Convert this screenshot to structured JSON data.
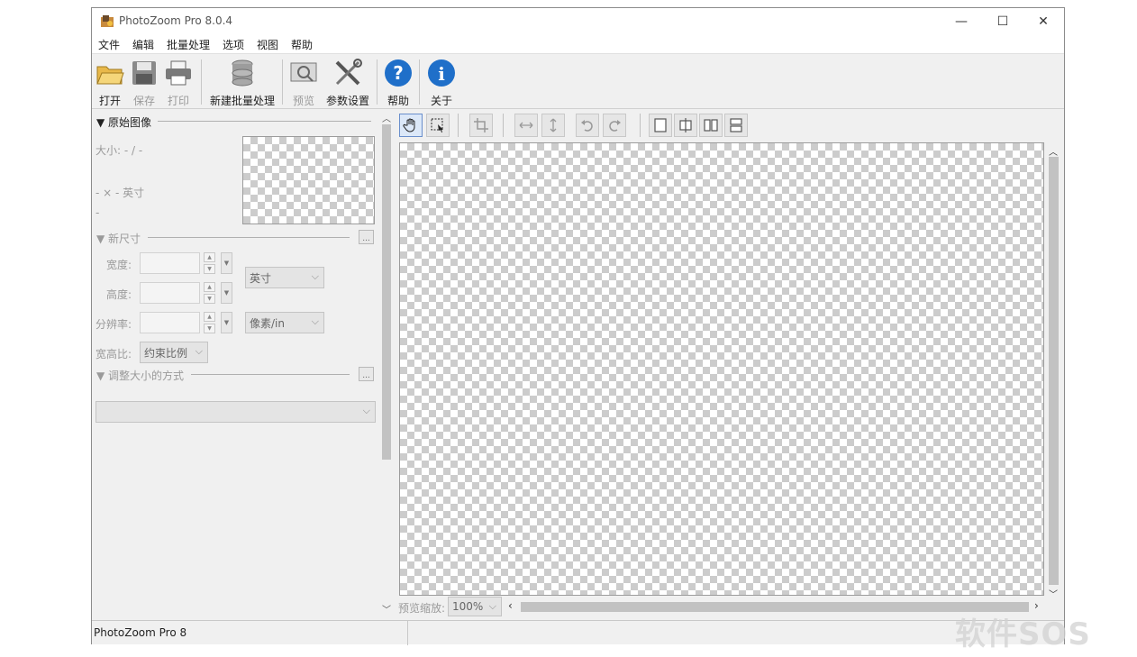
{
  "window": {
    "title": "PhotoZoom Pro 8.0.4",
    "controls": {
      "minimize": "—",
      "maximize": "☐",
      "close": "✕"
    }
  },
  "menu": [
    "文件",
    "编辑",
    "批量处理",
    "选项",
    "视图",
    "帮助"
  ],
  "toolbar": {
    "open": "打开",
    "save": "保存",
    "print": "打印",
    "new_batch": "新建批量处理",
    "preview": "预览",
    "settings": "参数设置",
    "help": "帮助",
    "about": "关于"
  },
  "left_panel": {
    "original_section": "▼ 原始图像",
    "size": "大小: - / -",
    "dimensions": "- × - 英寸",
    "resolution": "-",
    "new_size_section": "▼ 新尺寸",
    "width_label": "宽度:",
    "height_label": "高度:",
    "resolution_label": "分辨率:",
    "unit": "英寸",
    "resolution_unit": "像素/in",
    "aspect_label": "宽高比:",
    "aspect_value": "约束比例",
    "resize_method_section": "▼ 调整大小的方式",
    "resize_method_value": "",
    "more_button": "..."
  },
  "preview": {
    "zoom_label": "预览缩放:",
    "zoom_value": "100%"
  },
  "status": {
    "text": "PhotoZoom Pro 8"
  },
  "watermark": "软件SOS",
  "colors": {
    "help_icon": "#1f6fc9",
    "window_bg": "#f0f0f0",
    "checker_dark": "#cccccc"
  }
}
